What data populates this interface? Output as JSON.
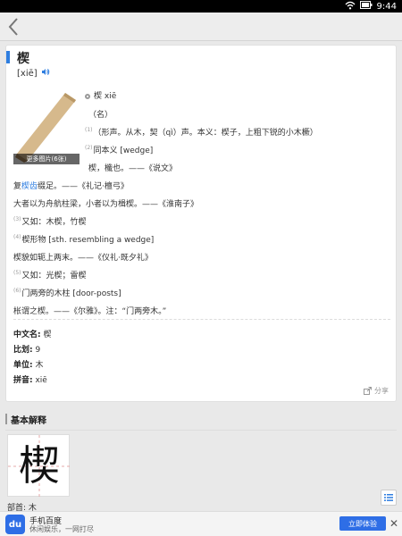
{
  "status": {
    "time": "9:44"
  },
  "header": {
    "back_icon": "chevron-left-icon"
  },
  "entry": {
    "title": "楔",
    "pinyin": "[xiē]",
    "more_pictures": "更多图片(6张)",
    "char_pinyin": "楔  xiē",
    "pos": "（名）",
    "def1": "（形声。从木，契（qì）声。本义：楔子，上粗下锐的小木橛）",
    "def2_prefix": "同本义",
    "def2_en": "[wedge]",
    "quote1": "楔，櫼也。——《说文》",
    "quote2_pre": "复",
    "quote2_link": "楔齿",
    "quote2_post": "缀足。——《礼记·檀弓》",
    "quote3": "大者以为舟航柱梁，小者以为楫楔。——《淮南子》",
    "def3": "又如：木楔，竹楔",
    "def4_prefix": "楔形物",
    "def4_en": "[sth. resembling a wedge]",
    "quote4": "楔貌如轭上两末。——《仪礼·既夕礼》",
    "def5": "又如：光楔；雷楔",
    "def6_prefix": "门两旁的木柱",
    "def6_en": "[door-posts]",
    "quote5": "枨谓之楔。——《尔雅》。注：“门两旁木。”",
    "sup1": "(1)",
    "sup2": "(2)",
    "sup3": "(3)",
    "sup4": "(4)",
    "sup5": "(5)",
    "sup6": "(6)"
  },
  "attributes": [
    {
      "label": "中文名:",
      "value": "楔"
    },
    {
      "label": "比划:",
      "value": "9"
    },
    {
      "label": "单位:",
      "value": "木"
    },
    {
      "label": "拼音:",
      "value": "xiē"
    }
  ],
  "share_label": "分享",
  "section2": {
    "title": "基本解释",
    "glyph": "楔",
    "radical_label": "部首:",
    "radical_value": "木"
  },
  "banner": {
    "app_name": "手机百度",
    "app_sub": "休闲娱乐，一网打尽",
    "open_label": "立即体验",
    "close_label": "✕",
    "app_icon_text": "du"
  },
  "colors": {
    "accent": "#2f7ee0",
    "banner_button": "#2e6ee6"
  }
}
